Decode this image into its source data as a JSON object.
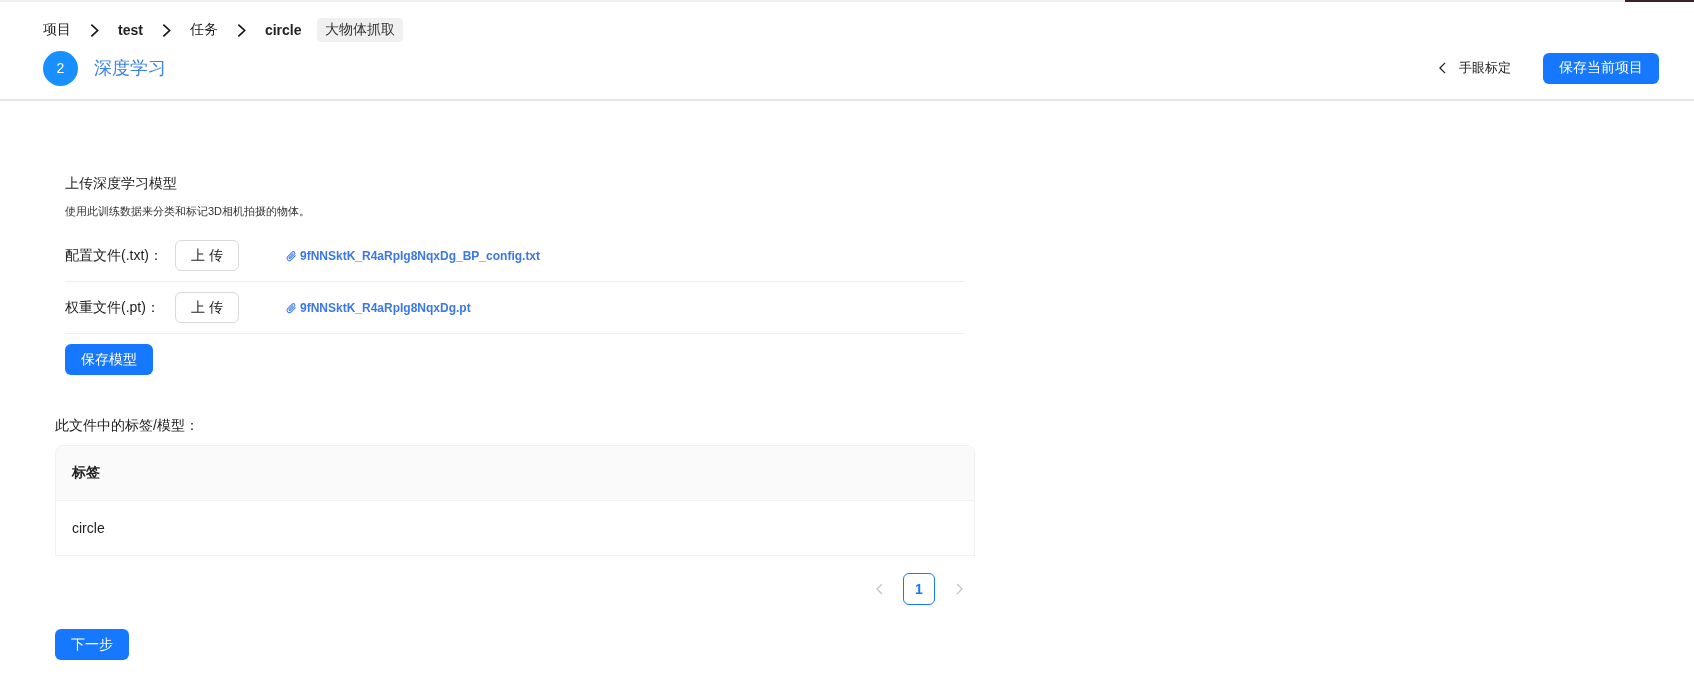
{
  "breadcrumb": {
    "items": [
      {
        "kind": "category",
        "label": "项目"
      },
      {
        "kind": "entry",
        "label": "test"
      },
      {
        "kind": "category",
        "label": "任务"
      },
      {
        "kind": "entry",
        "label": "circle"
      }
    ],
    "tag": "大物体抓取"
  },
  "step": {
    "number": "2",
    "title": "深度学习"
  },
  "header_actions": {
    "back_link": "手眼标定",
    "save_button": "保存当前项目"
  },
  "upload_section": {
    "title": "上传深度学习模型",
    "description": "使用此训练数据来分类和标记3D相机拍摄的物体。",
    "files": [
      {
        "label": "配置文件(.txt)：",
        "button": "上 传",
        "file_name": "9fNNSktK_R4aRpIg8NqxDg_BP_config.txt"
      },
      {
        "label": "权重文件(.pt)：",
        "button": "上 传",
        "file_name": "9fNNSktK_R4aRpIg8NqxDg.pt"
      }
    ],
    "save_button": "保存模型"
  },
  "labels_table": {
    "title": "此文件中的标签/模型：",
    "columns": [
      "标签"
    ],
    "rows": [
      [
        "circle"
      ]
    ]
  },
  "pagination": {
    "prev": {
      "disabled": true
    },
    "pages": [
      {
        "label": "1",
        "selected": true
      }
    ],
    "next": {
      "disabled": true
    }
  },
  "next_button": "下一步"
}
